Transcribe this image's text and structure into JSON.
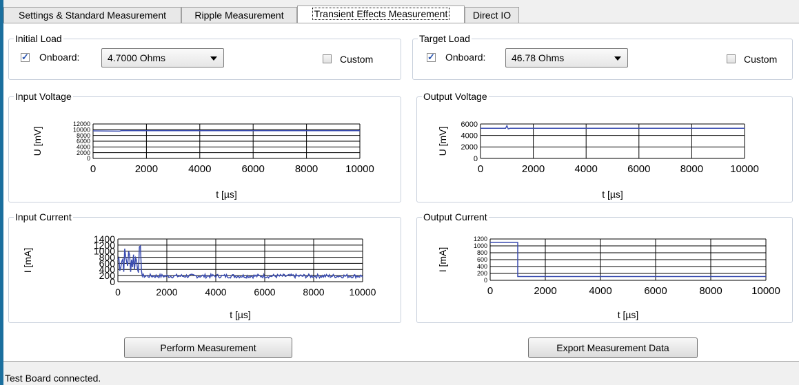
{
  "tabs": [
    {
      "label": "Settings & Standard Measurement"
    },
    {
      "label": "Ripple Measurement"
    },
    {
      "label": "Transient Effects Measurement"
    },
    {
      "label": "Direct IO"
    }
  ],
  "initial_load": {
    "title": "Initial Load",
    "onboard_label": "Onboard:",
    "onboard_checked": true,
    "value": "4.7000 Ohms",
    "custom_label": "Custom",
    "custom_checked": false
  },
  "target_load": {
    "title": "Target Load",
    "onboard_label": "Onboard:",
    "onboard_checked": true,
    "value": "46.78 Ohms",
    "custom_label": "Custom",
    "custom_checked": false
  },
  "buttons": {
    "perform": "Perform Measurement",
    "export": "Export Measurement Data"
  },
  "status": {
    "text": "Test Board connected."
  },
  "colors": {
    "series": "#3a4cb0",
    "grid": "#000000",
    "accent": "#1b6f9e"
  },
  "chart_data": [
    {
      "type": "line",
      "title": "Input Voltage",
      "xlabel": "t [µs]",
      "ylabel": "U [mV]",
      "xlim": [
        0,
        10000
      ],
      "ylim": [
        0,
        12000
      ],
      "xticks": [
        0,
        2000,
        4000,
        6000,
        8000,
        10000
      ],
      "yticks": [
        0,
        2000,
        4000,
        6000,
        8000,
        10000,
        12000
      ],
      "series": [
        {
          "x": [
            0,
            1000,
            1050,
            10000
          ],
          "y": [
            9600,
            9500,
            9650,
            9650
          ]
        }
      ],
      "grid": true
    },
    {
      "type": "line",
      "title": "Output Voltage",
      "xlabel": "t [µs]",
      "ylabel": "U [mV]",
      "xlim": [
        0,
        10000
      ],
      "ylim": [
        0,
        6000
      ],
      "xticks": [
        0,
        2000,
        4000,
        6000,
        8000,
        10000
      ],
      "yticks": [
        0,
        2000,
        4000,
        6000
      ],
      "series": [
        {
          "x": [
            0,
            950,
            1000,
            1050,
            1120,
            10000
          ],
          "y": [
            5250,
            5250,
            5700,
            5150,
            5250,
            5250
          ]
        }
      ],
      "grid": true
    },
    {
      "type": "line",
      "title": "Input Current",
      "xlabel": "t [µs]",
      "ylabel": "I [mA]",
      "xlim": [
        0,
        10000
      ],
      "ylim": [
        0,
        1400
      ],
      "xticks": [
        0,
        2000,
        4000,
        6000,
        8000,
        10000
      ],
      "yticks": [
        0,
        200,
        400,
        600,
        800,
        1000,
        1200,
        1400
      ],
      "series": [
        {
          "x": [
            0,
            100,
            200,
            300,
            400,
            500,
            600,
            700,
            800,
            900,
            1000,
            1000,
            1500,
            2000,
            3000,
            4000,
            5000,
            6000,
            7000,
            8000,
            9000,
            10000
          ],
          "y": [
            1150,
            300,
            1100,
            250,
            1150,
            350,
            1000,
            300,
            1150,
            250,
            1100,
            150,
            170,
            160,
            170,
            150,
            170,
            160,
            170,
            160,
            170,
            170
          ]
        }
      ],
      "grid": true
    },
    {
      "type": "line",
      "title": "Output Current",
      "xlabel": "t [µs]",
      "ylabel": "I [mA]",
      "xlim": [
        0,
        10000
      ],
      "ylim": [
        0,
        1200
      ],
      "xticks": [
        0,
        2000,
        4000,
        6000,
        8000,
        10000
      ],
      "yticks": [
        0,
        200,
        400,
        600,
        800,
        1000,
        1200
      ],
      "series": [
        {
          "x": [
            0,
            1000,
            1000,
            10000
          ],
          "y": [
            1100,
            1100,
            110,
            110
          ]
        }
      ],
      "grid": true
    }
  ]
}
